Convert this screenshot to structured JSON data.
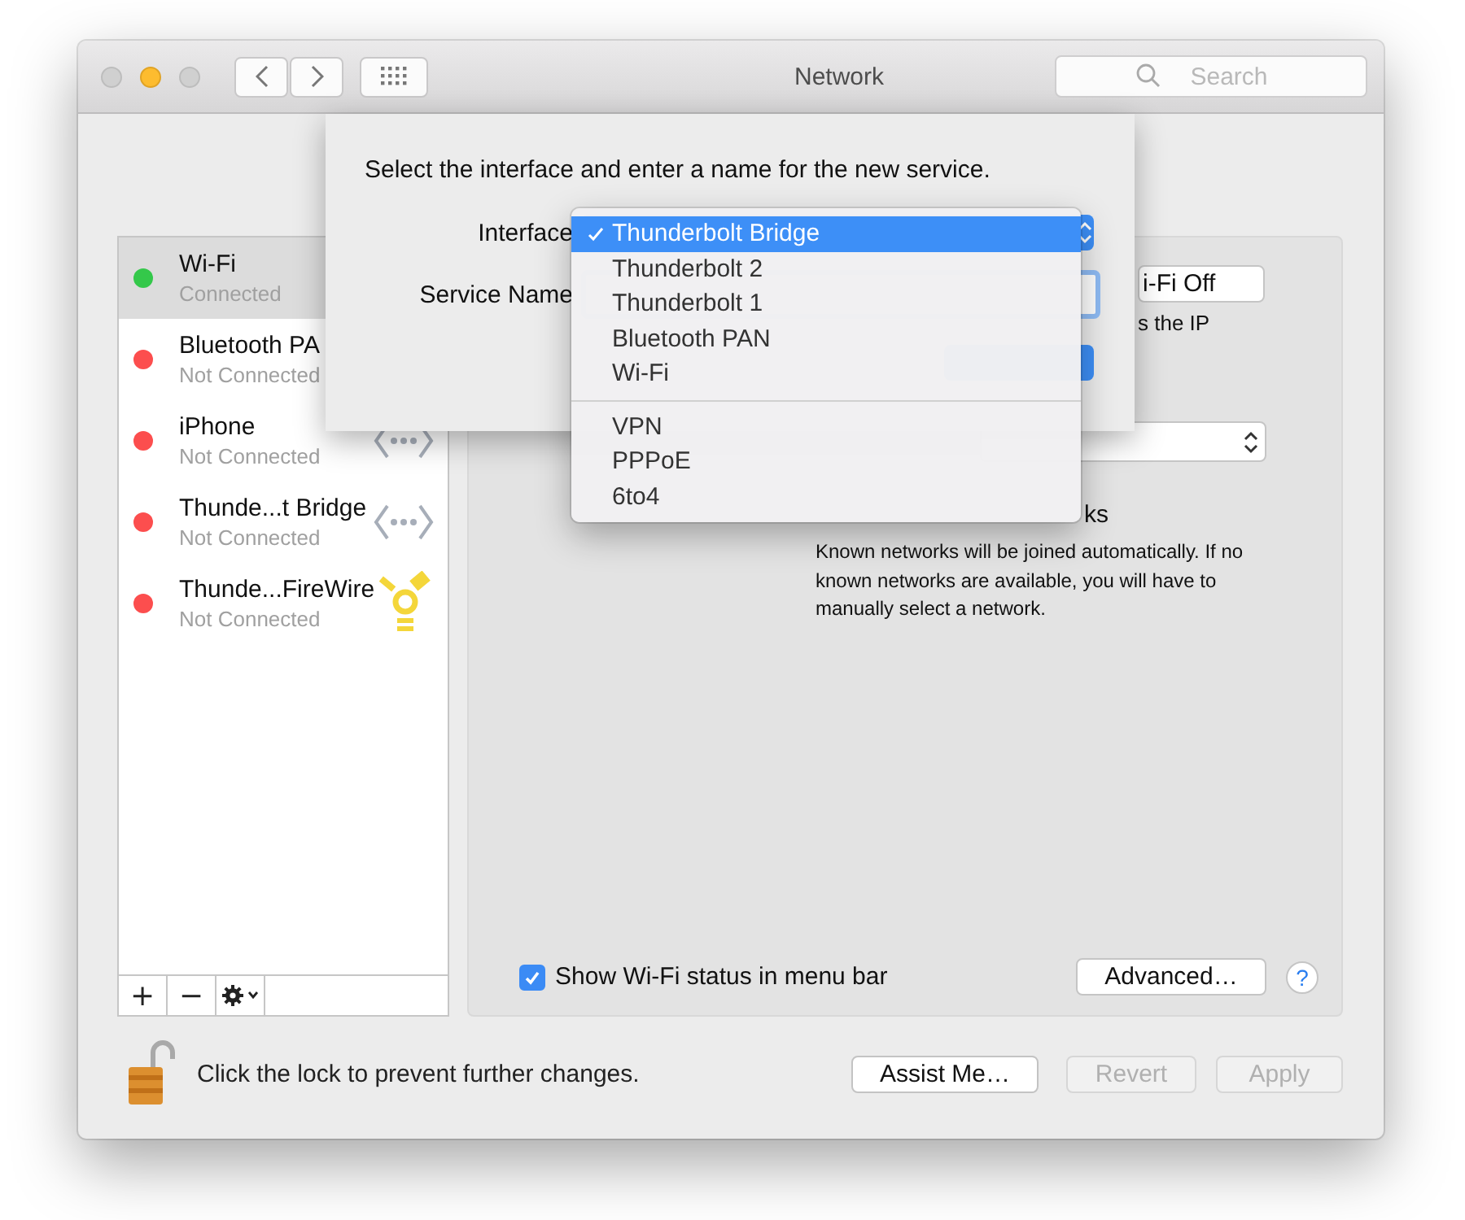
{
  "window": {
    "title": "Network"
  },
  "toolbar": {
    "search": {
      "placeholder": "Search"
    }
  },
  "services": [
    {
      "name": "Wi-Fi",
      "status": "Connected",
      "selected": true,
      "color": "#34c84a",
      "kind": "plain"
    },
    {
      "name": "Bluetooth PA",
      "status": "Not Connected",
      "selected": false,
      "color": "#fc4e4e",
      "kind": "plain"
    },
    {
      "name": "iPhone",
      "status": "Not Connected",
      "selected": false,
      "color": "#fc4e4e",
      "kind": "ethernet"
    },
    {
      "name": "Thunde...t Bridge",
      "status": "Not Connected",
      "selected": false,
      "color": "#fc4e4e",
      "kind": "ethernet"
    },
    {
      "name": "Thunde...FireWire",
      "status": "Not Connected",
      "selected": false,
      "color": "#fc4e4e",
      "kind": "firewire"
    }
  ],
  "service_buttons": [
    "+",
    "−"
  ],
  "detail": {
    "wifi_button": "i-Fi Off",
    "status_fragment": "s the IP",
    "option_fragment": "ks",
    "auto_join_note": "Known networks will be joined automatically. If no known networks are available, you will have to manually select a network.",
    "show_status": {
      "label": "Show Wi-Fi status in menu bar",
      "checked": true
    },
    "advanced_button": "Advanced…",
    "help": "?"
  },
  "footer": {
    "lock_text": "Click the lock to prevent further changes.",
    "buttons": [
      {
        "label": "Assist Me…",
        "disabled": false
      },
      {
        "label": "Revert",
        "disabled": true
      },
      {
        "label": "Apply",
        "disabled": true
      }
    ]
  },
  "sheet": {
    "prompt": "Select the interface and enter a name for the new service.",
    "interface_label": "Interface",
    "service_name_label": "Service Name",
    "interface_menu": {
      "groups": [
        {
          "items": [
            {
              "label": "Thunderbolt Bridge",
              "selected": true
            },
            {
              "label": "Thunderbolt 2",
              "selected": false
            },
            {
              "label": "Thunderbolt 1",
              "selected": false
            },
            {
              "label": "Bluetooth PAN",
              "selected": false
            },
            {
              "label": "Wi-Fi",
              "selected": false
            }
          ]
        },
        {
          "items": [
            {
              "label": "VPN",
              "selected": false
            },
            {
              "label": "PPPoE",
              "selected": false
            },
            {
              "label": "6to4",
              "selected": false
            }
          ]
        }
      ]
    }
  }
}
